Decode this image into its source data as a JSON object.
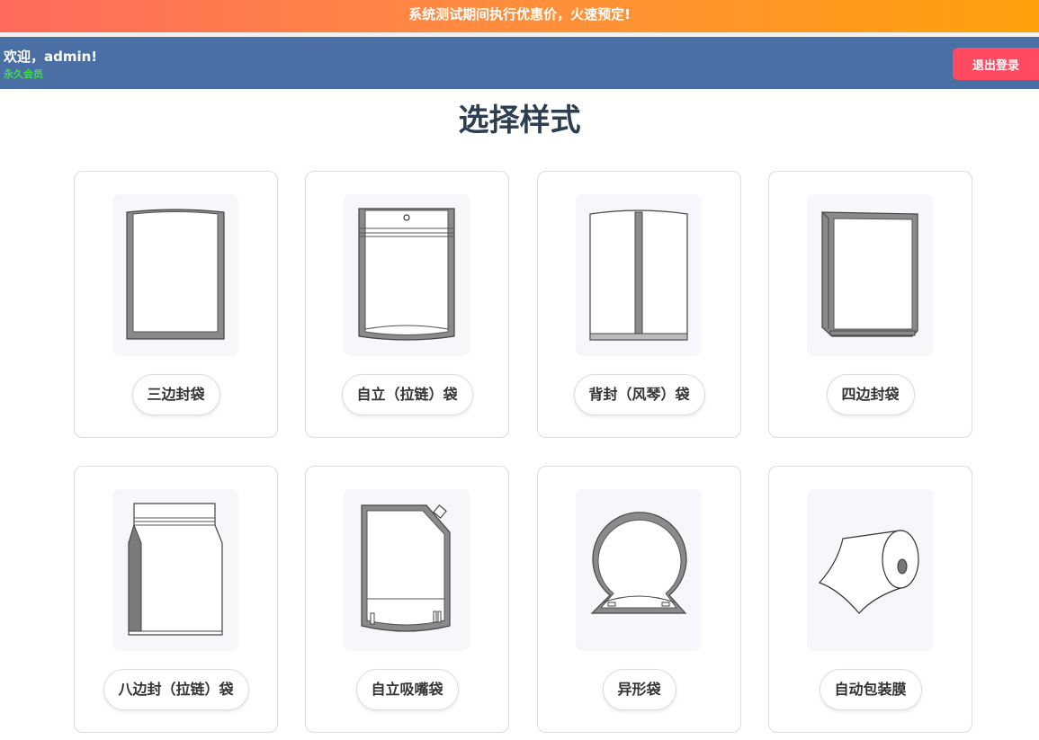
{
  "promo": {
    "text": "系统测试期间执行优惠价，火速预定!"
  },
  "header": {
    "welcome": "欢迎，admin!",
    "membership": "永久会员",
    "logout_label": "退出登录"
  },
  "page": {
    "title": "选择样式"
  },
  "styles": [
    {
      "label": "三边封袋",
      "icon": "three-side-seal-bag-icon"
    },
    {
      "label": "自立（拉链）袋",
      "icon": "stand-up-zipper-bag-icon"
    },
    {
      "label": "背封（风琴）袋",
      "icon": "back-seal-gusset-bag-icon"
    },
    {
      "label": "四边封袋",
      "icon": "four-side-seal-bag-icon"
    },
    {
      "label": "八边封（拉链）袋",
      "icon": "eight-side-seal-zipper-bag-icon"
    },
    {
      "label": "自立吸嘴袋",
      "icon": "spout-pouch-icon"
    },
    {
      "label": "异形袋",
      "icon": "shaped-bag-icon"
    },
    {
      "label": "自动包装膜",
      "icon": "film-roll-icon"
    }
  ]
}
